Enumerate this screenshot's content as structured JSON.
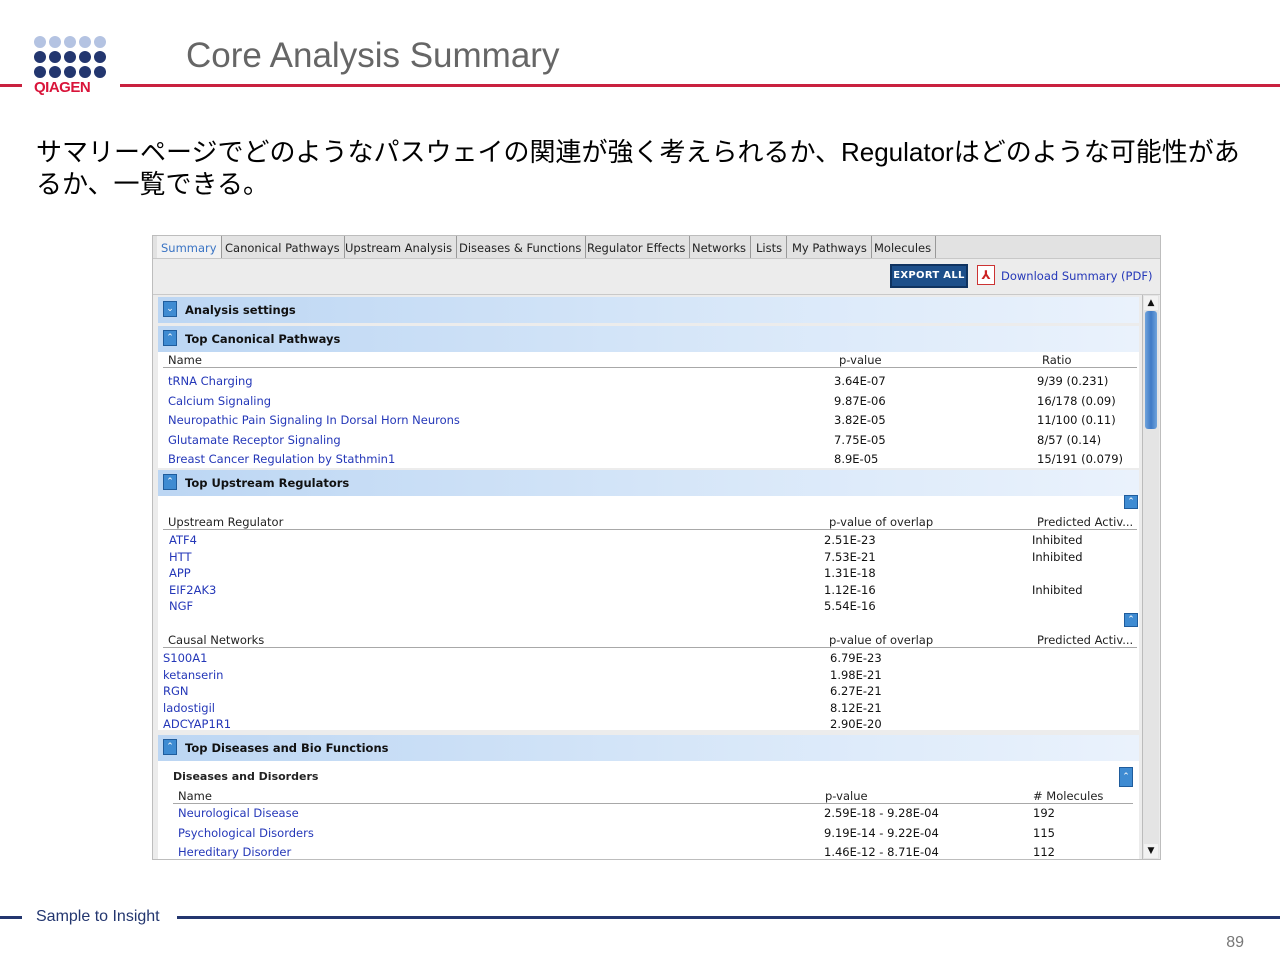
{
  "slide": {
    "logo_text": "QIAGEN",
    "logo_colors": {
      "dots_light": "#b4c3e2",
      "dots_dark": "#23366f",
      "text": "#d9143a"
    },
    "title": "Core Analysis Summary",
    "subtitle": "サマリーページでどのようなパスウェイの関連が強く考えられるか、Regulatorはどのような可能性があるか、一覧できる。",
    "footer": "Sample to Insight",
    "page_number": "89",
    "accent_red": "#c9213f",
    "accent_navy": "#23366f"
  },
  "app": {
    "tabs": [
      "Summary",
      "Canonical Pathways",
      "Upstream Analysis",
      "Diseases & Functions",
      "Regulator Effects",
      "Networks",
      "Lists",
      "My Pathways",
      "Molecules"
    ],
    "active_tab": "Summary",
    "toolbar": {
      "export_label": "EXPORT ALL",
      "pdf_icon": "pdf-icon",
      "download_label": "Download Summary (PDF)"
    },
    "analysis_settings": {
      "label": "Analysis settings",
      "toggle": "expand-icon"
    },
    "canonical": {
      "label": "Top Canonical Pathways",
      "headers": {
        "name": "Name",
        "pvalue": "p-value",
        "ratio": "Ratio"
      },
      "rows": [
        {
          "name": "tRNA Charging",
          "pvalue": "3.64E-07",
          "ratio": "9/39 (0.231)"
        },
        {
          "name": "Calcium Signaling",
          "pvalue": "9.87E-06",
          "ratio": "16/178 (0.09)"
        },
        {
          "name": "Neuropathic Pain Signaling In Dorsal Horn Neurons",
          "pvalue": "3.82E-05",
          "ratio": "11/100 (0.11)"
        },
        {
          "name": "Glutamate Receptor Signaling",
          "pvalue": "7.75E-05",
          "ratio": "8/57 (0.14)"
        },
        {
          "name": "Breast Cancer Regulation by Stathmin1",
          "pvalue": "8.9E-05",
          "ratio": "15/191 (0.079)"
        }
      ]
    },
    "upstream": {
      "label": "Top Upstream Regulators",
      "regulators_headers": {
        "name": "Upstream Regulator",
        "pvalue": "p-value of overlap",
        "activation": "Predicted Activ..."
      },
      "regulators": [
        {
          "name": "ATF4",
          "pvalue": "2.51E-23",
          "activation": "Inhibited"
        },
        {
          "name": "HTT",
          "pvalue": "7.53E-21",
          "activation": "Inhibited"
        },
        {
          "name": "APP",
          "pvalue": "1.31E-18",
          "activation": ""
        },
        {
          "name": "EIF2AK3",
          "pvalue": "1.12E-16",
          "activation": "Inhibited"
        },
        {
          "name": "NGF",
          "pvalue": "5.54E-16",
          "activation": ""
        }
      ],
      "networks_headers": {
        "name": "Causal Networks",
        "pvalue": "p-value of overlap",
        "activation": "Predicted Activ..."
      },
      "networks": [
        {
          "name": "S100A1",
          "pvalue": "6.79E-23"
        },
        {
          "name": "ketanserin",
          "pvalue": "1.98E-21"
        },
        {
          "name": "RGN",
          "pvalue": "6.27E-21"
        },
        {
          "name": "ladostigil",
          "pvalue": "8.12E-21"
        },
        {
          "name": "ADCYAP1R1",
          "pvalue": "2.90E-20"
        }
      ]
    },
    "diseases": {
      "label": "Top Diseases and Bio Functions",
      "subheader": "Diseases and Disorders",
      "headers": {
        "name": "Name",
        "pvalue": "p-value",
        "molecules": "# Molecules"
      },
      "rows": [
        {
          "name": "Neurological Disease",
          "pvalue": "2.59E-18 - 9.28E-04",
          "molecules": "192"
        },
        {
          "name": "Psychological Disorders",
          "pvalue": "9.19E-14 - 9.22E-04",
          "molecules": "115"
        },
        {
          "name": "Hereditary Disorder",
          "pvalue": "1.46E-12 - 8.71E-04",
          "molecules": "112"
        }
      ]
    }
  }
}
